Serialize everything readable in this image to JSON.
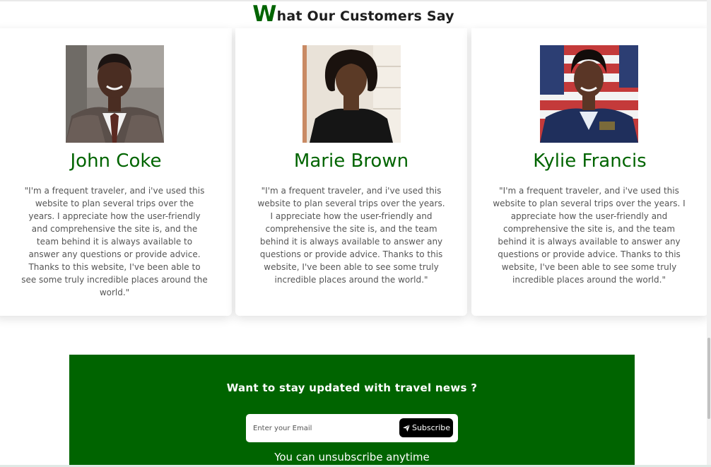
{
  "testimonials": {
    "heading_first_letter": "W",
    "heading_rest": "hat Our Customers Say",
    "cards": [
      {
        "name": "John Coke",
        "photo_icon": "portrait-man-suit",
        "quote": "\"I'm a frequent traveler, and i've used this website to plan several trips over the years. I appreciate how the user-friendly and comprehensive the site is, and the team behind it is always available to answer any questions or provide advice. Thanks to this website, I've been able to see some truly incredible places around the world.\""
      },
      {
        "name": "Marie Brown",
        "photo_icon": "portrait-woman-black-blouse",
        "quote": "\"I'm a frequent traveler, and i've used this website to plan several trips over the years. I appreciate how the user-friendly and comprehensive the site is, and the team behind it is always available to answer any questions or provide advice. Thanks to this website, I've been able to see some truly incredible places around the world.\""
      },
      {
        "name": "Kylie Francis",
        "photo_icon": "portrait-woman-uniform-flag",
        "quote": "\"I'm a frequent traveler, and i've used this website to plan several trips over the years. I appreciate how the user-friendly and comprehensive the site is, and the team behind it is always available to answer any questions or provide advice. Thanks to this website, I've been able to see some truly incredible places around the world.\""
      }
    ]
  },
  "newsletter": {
    "title": "Want to stay updated with travel news ?",
    "email_placeholder": "Enter your Email",
    "email_value": "",
    "subscribe_label": "Subscribe",
    "subscribe_icon": "paper-plane-icon",
    "note": "You can unsubscribe anytime"
  },
  "colors": {
    "accent_green": "#006400",
    "button_black": "#000000",
    "text_gray": "#555555"
  }
}
